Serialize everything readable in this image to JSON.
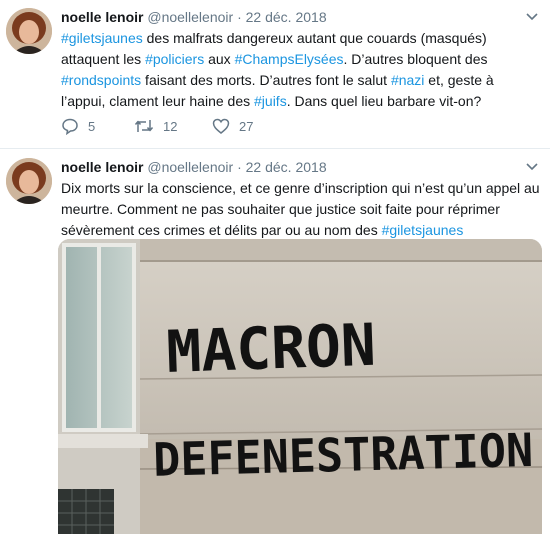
{
  "tweets": [
    {
      "name": "noelle lenoir",
      "handle": "@noellelenoir",
      "sep": "·",
      "date": "22 déc. 2018",
      "text": [
        {
          "t": "#giletsjaunes",
          "tag": true
        },
        {
          "t": " des malfrats dangereux autant que couards (masqués) attaquent les ",
          "tag": false
        },
        {
          "t": "#policiers",
          "tag": true
        },
        {
          "t": " aux ",
          "tag": false
        },
        {
          "t": "#ChampsElysées",
          "tag": true
        },
        {
          "t": ". D’autres bloquent des ",
          "tag": false
        },
        {
          "t": "#rondspoints",
          "tag": true
        },
        {
          "t": " faisant des morts. D’autres font le salut ",
          "tag": false
        },
        {
          "t": "#nazi",
          "tag": true
        },
        {
          "t": " et, geste à l’appui, clament leur haine des ",
          "tag": false
        },
        {
          "t": "#juifs",
          "tag": true
        },
        {
          "t": ". Dans quel lieu barbare vit-on?",
          "tag": false
        }
      ],
      "replies": "5",
      "retweets": "12",
      "likes": "27"
    },
    {
      "name": "noelle lenoir",
      "handle": "@noellelenoir",
      "sep": "·",
      "date": "22 déc. 2018",
      "text": [
        {
          "t": "Dix morts sur la conscience, et ce genre d’inscription qui n’est qu’un appel au meurtre. Comment ne pas souhaiter que justice soit faite pour réprimer sévèrement ces crimes et délits par ou au nom des ",
          "tag": false
        },
        {
          "t": "#giletsjaunes",
          "tag": true
        }
      ],
      "image": {
        "graffiti_line1": "MACRON",
        "graffiti_line2": "DEFENESTRATION"
      }
    }
  ],
  "colors": {
    "hashtag": "#1b95e0",
    "muted": "#657786",
    "text": "#14171a",
    "divider": "#e6ecf0"
  },
  "icons": [
    "chevron-down-icon",
    "reply-icon",
    "retweet-icon",
    "like-icon"
  ]
}
